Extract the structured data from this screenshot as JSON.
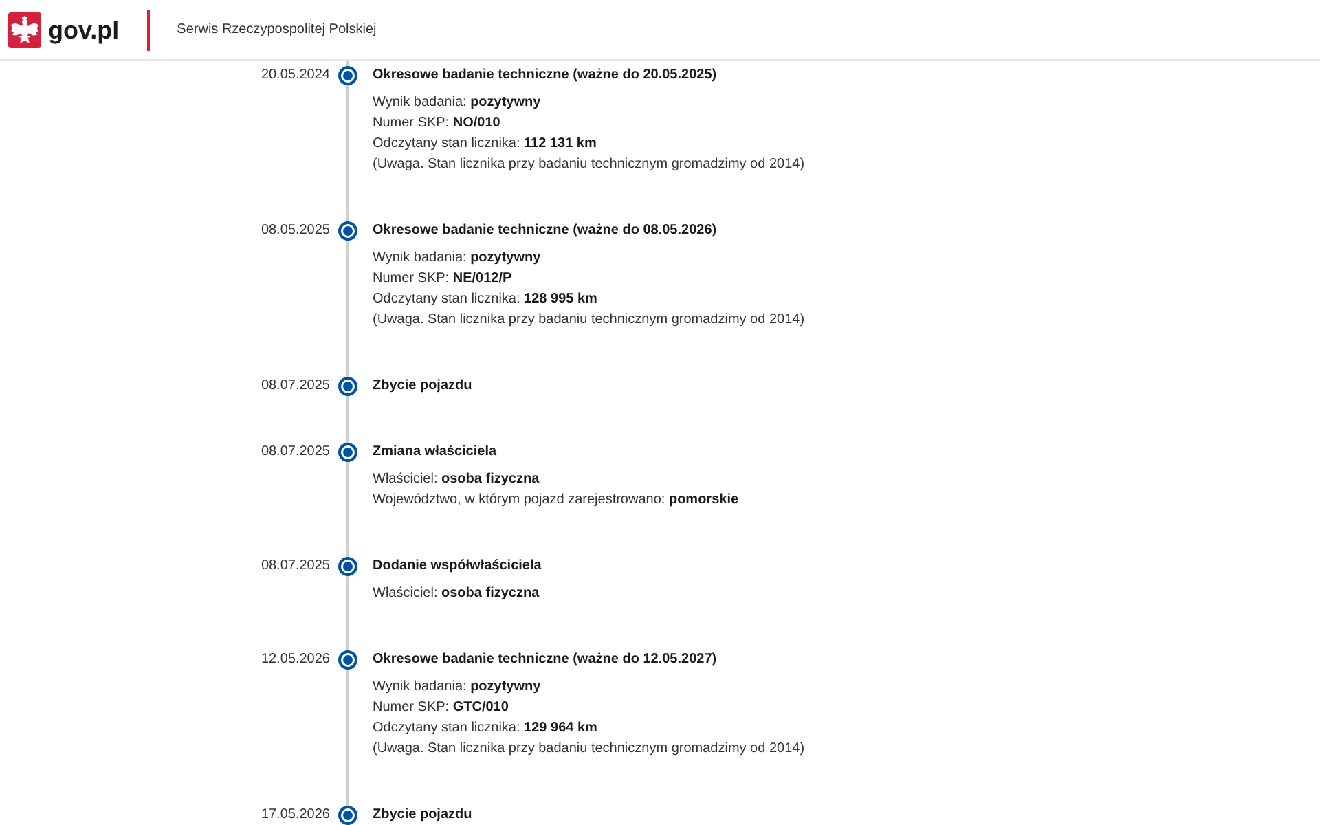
{
  "header": {
    "logo_text": "gov.pl",
    "service_name": "Serwis Rzeczypospolitej Polskiej"
  },
  "timeline": [
    {
      "date": "20.05.2024",
      "title": "Okresowe badanie techniczne (ważne do 20.05.2025)",
      "details": [
        "Wynik badania: **pozytywny**",
        "Numer SKP: **NO/010**",
        "Odczytany stan licznika: **112 131 km**",
        "(Uwaga. Stan licznika przy badaniu technicznym gromadzimy od 2014)"
      ]
    },
    {
      "date": "08.05.2025",
      "title": "Okresowe badanie techniczne (ważne do 08.05.2026)",
      "details": [
        "Wynik badania: **pozytywny**",
        "Numer SKP: **NE/012/P**",
        "Odczytany stan licznika: **128 995 km**",
        "(Uwaga. Stan licznika przy badaniu technicznym gromadzimy od 2014)"
      ]
    },
    {
      "date": "08.07.2025",
      "title": "Zbycie pojazdu"
    },
    {
      "date": "08.07.2025",
      "title": "Zmiana właściciela",
      "details": [
        "Właściciel: **osoba fizyczna**",
        "Województwo, w którym pojazd zarejestrowano: **pomorskie**"
      ]
    },
    {
      "date": "08.07.2025",
      "title": "Dodanie współwłaściciela",
      "details": [
        "Właściciel: **osoba fizyczna**"
      ]
    },
    {
      "date": "12.05.2026",
      "title": "Okresowe badanie techniczne (ważne do 12.05.2027)",
      "details": [
        "Wynik badania: **pozytywny**",
        "Numer SKP: **GTC/010**",
        "Odczytany stan licznika: **129 964 km**",
        "(Uwaga. Stan licznika przy badaniu technicznym gromadzimy od 2014)"
      ]
    },
    {
      "date": "17.05.2026",
      "title": "Zbycie pojazdu"
    }
  ]
}
